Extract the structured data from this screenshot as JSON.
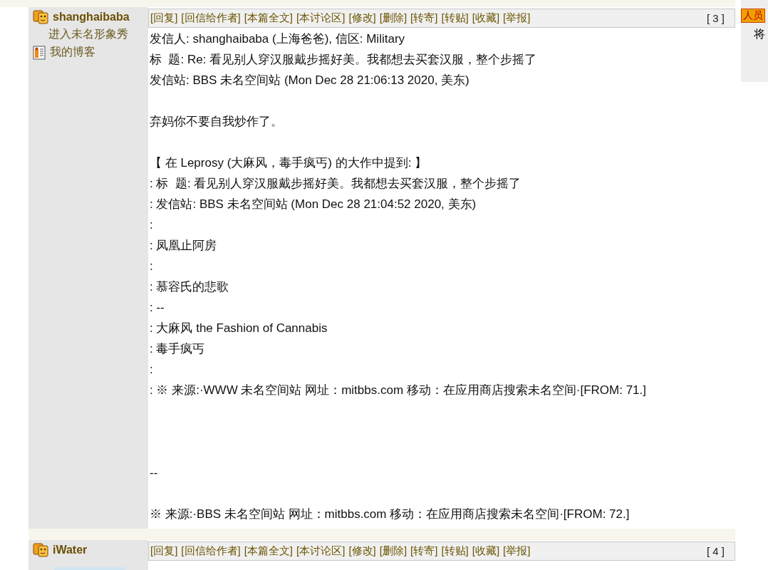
{
  "posts": [
    {
      "author": "shanghaibaba",
      "profile_links": [
        {
          "label": "进入未名形象秀",
          "kind": "show"
        },
        {
          "label": "我的博客",
          "kind": "blog"
        }
      ],
      "actions": [
        "[回复]",
        "[回信给作者]",
        "[本篇全文]",
        "[本讨论区]",
        "[修改]",
        "[删除]",
        "[转寄]",
        "[转贴]",
        "[收藏]",
        "[举报]"
      ],
      "floor": "[ 3 ]",
      "paragraphs": [
        {
          "kind": "header",
          "lines": [
            "发信人: shanghaibaba (上海爸爸), 信区: Military",
            "标  题: Re: 看见别人穿汉服戴步摇好美。我都想去买套汉服，整个步摇了",
            "发信站: BBS 未名空间站 (Mon Dec 28 21:06:13 2020, 美东)"
          ]
        },
        {
          "kind": "text",
          "lines": [
            "弃妈你不要自我炒作了。"
          ]
        },
        {
          "kind": "quote",
          "lines": [
            "【 在 Leprosy (大麻风，毒手疯丐) 的大作中提到: 】",
            ": 标  题: 看见别人穿汉服戴步摇好美。我都想去买套汉服，整个步摇了",
            ": 发信站: BBS 未名空间站 (Mon Dec 28 21:04:52 2020, 美东)",
            ":",
            ": 凤凰止阿房",
            ":",
            ": 慕容氏的悲歌",
            ": --",
            ": 大麻风 the Fashion of Cannabis",
            ": 毒手疯丐",
            ":",
            ": ※ 来源:·WWW 未名空间站 网址：mitbbs.com 移动：在应用商店搜索未名空间·[FROM: 71.]"
          ]
        },
        {
          "kind": "signature",
          "lines": [
            "--"
          ]
        },
        {
          "kind": "origin",
          "lines": [
            "※ 来源:·BBS 未名空间站 网址：mitbbs.com 移动：在应用商店搜索未名空间·[FROM: 72.]"
          ]
        }
      ]
    },
    {
      "author": "iWater",
      "avatar": true,
      "actions": [
        "[回复]",
        "[回信给作者]",
        "[本篇全文]",
        "[本讨论区]",
        "[修改]",
        "[删除]",
        "[转寄]",
        "[转贴]",
        "[收藏]",
        "[举报]"
      ],
      "floor": "[ 4 ]"
    }
  ],
  "ad": {
    "banner": "人员",
    "text": "将"
  }
}
